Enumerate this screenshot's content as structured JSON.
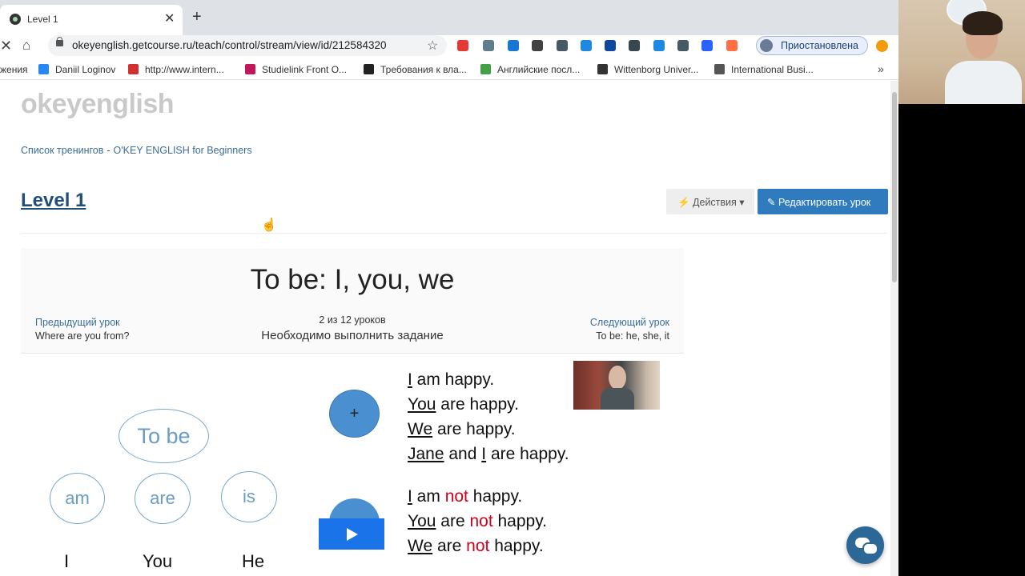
{
  "tab": {
    "title": "Level 1",
    "close": "✕",
    "new_tab": "+"
  },
  "toolbar": {
    "stop": "✕",
    "home": "⌂",
    "url": "okeyenglish.getcourse.ru/teach/control/stream/view/id/212584320",
    "star": "☆",
    "profile_label": "Приостановлена"
  },
  "extensions": [
    "#e53935",
    "#607d8b",
    "#1976d2",
    "#424242",
    "#455a64",
    "#1e88e5",
    "#0d47a1",
    "#37474f",
    "#1e88e5",
    "#455a64",
    "#2962ff",
    "#ff7043"
  ],
  "bookmarks": [
    {
      "label": "жения",
      "icon": "none"
    },
    {
      "label": "Daniil Loginov",
      "icon": "#2787f5"
    },
    {
      "label": "http://www.intern...",
      "icon": "#d32f2f"
    },
    {
      "label": "Studielink Front O...",
      "icon": "#c2185b"
    },
    {
      "label": "Требования к вла...",
      "icon": "#222222"
    },
    {
      "label": "Английские посл...",
      "icon": "#43a047"
    },
    {
      "label": "Wittenborg Univer...",
      "icon": "#333333"
    },
    {
      "label": "International Busi...",
      "icon": "#555555"
    }
  ],
  "bookmarks_more": "»",
  "page": {
    "logo": "okeyenglish",
    "breadcrumb": {
      "root": "Список тренингов",
      "sep": "-",
      "course": "O'KEY ENGLISH for Beginners"
    },
    "lesson_title": "Level 1",
    "actions_label": "⚡ Действия ▾",
    "edit_label": "✎ Редактировать урок",
    "lesson": {
      "name": "To be: I, you, we",
      "prev_label": "Предыдущий урок",
      "prev_name": "Where are you from?",
      "counter": "2 из 12 уроков",
      "status": "Необходимо выполнить задание",
      "next_label": "Следующий урок",
      "next_name": "To be: he, she, it"
    }
  },
  "slide": {
    "to_be": "To be",
    "forms": [
      "am",
      "are",
      "is"
    ],
    "pronouns": [
      "I",
      "You",
      "He"
    ],
    "plus": "+",
    "positive": [
      {
        "pre": "",
        "u": "I",
        "rest": " am happy."
      },
      {
        "pre": "",
        "u": "You",
        "rest": " are happy."
      },
      {
        "pre": "",
        "u": "We",
        "rest": " are happy."
      }
    ],
    "positive_last": {
      "u1": "Jane",
      "mid": " and ",
      "u2": "I",
      "rest": " are happy."
    },
    "negative": [
      {
        "u": "I",
        "mid": " am ",
        "neg": "not",
        "rest": " happy."
      },
      {
        "u": "You",
        "mid": " are ",
        "neg": "not",
        "rest": " happy."
      },
      {
        "u": "We",
        "mid": " are ",
        "neg": "not",
        "rest": " happy."
      }
    ]
  }
}
